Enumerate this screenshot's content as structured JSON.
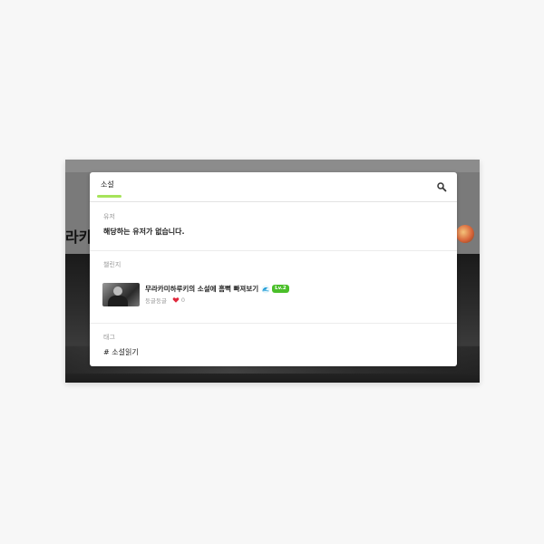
{
  "background_page": {
    "title_fragment": "라카미"
  },
  "search": {
    "value": "소설",
    "placeholder": "",
    "accent_color": "#a6e35a"
  },
  "sections": {
    "users": {
      "label": "유저",
      "empty_message": "해당하는 유저가 없습니다."
    },
    "challenges": {
      "label": "챌린지",
      "items": [
        {
          "title": "무라카미하루키의 소설에 흠뻑 빠져보기",
          "badge": "Lv.2",
          "badge_color": "#4bbf2a",
          "status": "둥글둥글",
          "likes": "0",
          "icon": "wave-icon"
        }
      ]
    },
    "tags": {
      "label": "태그",
      "items": [
        "# 소설읽기"
      ]
    }
  },
  "icons": {
    "search": "search-icon",
    "heart": "heart-icon",
    "heart_color": "#e0283c"
  }
}
